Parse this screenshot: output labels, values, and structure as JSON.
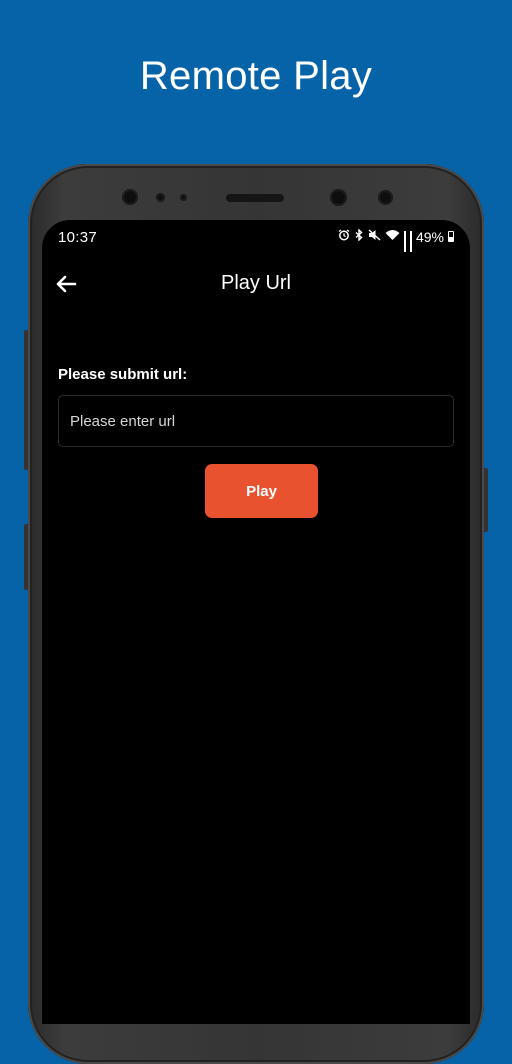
{
  "promo": {
    "title": "Remote Play"
  },
  "status_bar": {
    "time": "10:37",
    "battery_percent": "49%",
    "icons": [
      "alarm-icon",
      "bluetooth-icon",
      "mute-icon",
      "wifi-icon",
      "signal-icon",
      "battery-icon"
    ]
  },
  "app_bar": {
    "title": "Play Url",
    "back_icon": "arrow-left-icon"
  },
  "form": {
    "label": "Please submit url:",
    "url_input": {
      "value": "",
      "placeholder": "Please enter url"
    },
    "play_label": "Play"
  },
  "colors": {
    "background": "#0763a8",
    "screen": "#000000",
    "accent": "#e8522f",
    "text": "#ffffff"
  }
}
